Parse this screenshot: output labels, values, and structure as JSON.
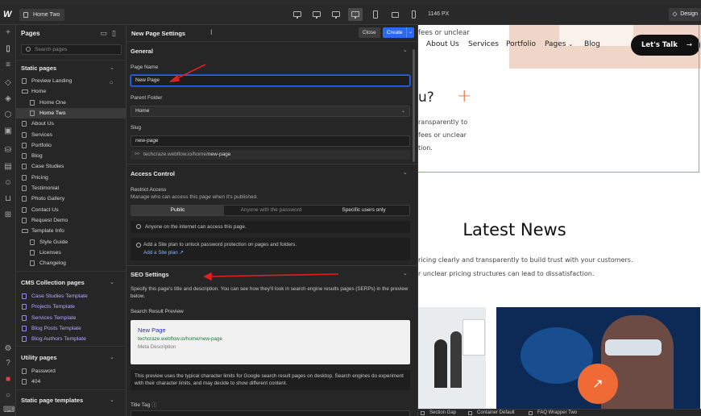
{
  "topbar": {
    "current_page": "Home Two",
    "width_readout": "1146 PX",
    "design_label": "Design"
  },
  "pages_panel": {
    "title": "Pages",
    "search_placeholder": "Search pages",
    "static_header": "Static pages",
    "static_items": [
      {
        "label": "Preview Landing",
        "type": "page",
        "level": 0
      },
      {
        "label": "Home",
        "type": "folder",
        "level": 0
      },
      {
        "label": "Home One",
        "type": "page",
        "level": 1
      },
      {
        "label": "Home Two",
        "type": "page",
        "level": 1
      },
      {
        "label": "About Us",
        "type": "page",
        "level": 0
      },
      {
        "label": "Services",
        "type": "page",
        "level": 0
      },
      {
        "label": "Portfolio",
        "type": "page",
        "level": 0
      },
      {
        "label": "Blog",
        "type": "page",
        "level": 0
      },
      {
        "label": "Case Studies",
        "type": "page",
        "level": 0
      },
      {
        "label": "Pricing",
        "type": "page",
        "level": 0
      },
      {
        "label": "Testimonial",
        "type": "page",
        "level": 0
      },
      {
        "label": "Photo Gallery",
        "type": "page",
        "level": 0
      },
      {
        "label": "Contact Us",
        "type": "page",
        "level": 0
      },
      {
        "label": "Request Demo",
        "type": "page",
        "level": 0
      },
      {
        "label": "Template Info",
        "type": "folder",
        "level": 0
      },
      {
        "label": "Style Guide",
        "type": "page",
        "level": 1
      },
      {
        "label": "Licenses",
        "type": "page",
        "level": 1
      },
      {
        "label": "Changelog",
        "type": "page",
        "level": 1
      }
    ],
    "cms_header": "CMS Collection pages",
    "cms_items": [
      "Case Studies Template",
      "Projects Template",
      "Services Template",
      "Blog Posts Template",
      "Blog Authors Template"
    ],
    "utility_header": "Utility pages",
    "utility_items": [
      "Password",
      "404"
    ],
    "templates_header": "Static page templates"
  },
  "settings": {
    "title": "New Page Settings",
    "close_label": "Close",
    "create_label": "Create",
    "general_header": "General",
    "page_name_label": "Page Name",
    "page_name_value": "New Page",
    "parent_folder_label": "Parent Folder",
    "parent_folder_value": "Home",
    "slug_label": "Slug",
    "slug_value": "new-page",
    "url_prefix": "techcraze.webflow.io/home/",
    "url_slug": "new-page",
    "access_header": "Access Control",
    "restrict_label": "Restrict Access",
    "restrict_desc": "Manage who can access this page when it's published.",
    "access_options": [
      "Public",
      "Anyone with the password",
      "Specific users only"
    ],
    "access_notice": "Anyone on the internet can access this page.",
    "plan_notice": "Add a Site plan to unlock password protection on pages and folders.",
    "plan_link": "Add a Site plan ↗",
    "seo_header": "SEO Settings",
    "seo_desc": "Specify this page's title and description. You can see how they'll look in search engine results pages (SERPs) in the preview below.",
    "serp_label": "Search Result Preview",
    "serp_title": "New Page",
    "serp_url": "techcraze.webflow.io/home/new-page",
    "serp_desc": "Meta Description",
    "serp_note": "This preview uses the typical character limits for Google search result pages on desktop. Search engines do experiment with their character limits, and may decide to show different content.",
    "title_tag_label": "Title Tag"
  },
  "canvas": {
    "hero_line1": "fees or unclear",
    "nav": [
      "About Us",
      "Services",
      "Portfolio",
      "Pages",
      "Blog"
    ],
    "cta": "Let's Talk",
    "q_fragment": "u?",
    "body_lines": [
      "ransparently to",
      "fees or unclear",
      "tion."
    ],
    "news_title": "Latest News",
    "news_sub1": "ricing clearly and transparently to build trust with your customers.",
    "news_sub2": "r unclear pricing structures can lead to dissatisfaction.",
    "status_items": [
      "Section Gap",
      "Container Default",
      "FAQ Wrapper Two"
    ]
  },
  "colors": {
    "accent": "#2a6af0",
    "brand_orange": "#f06a35",
    "annotation_red": "#e02020"
  }
}
